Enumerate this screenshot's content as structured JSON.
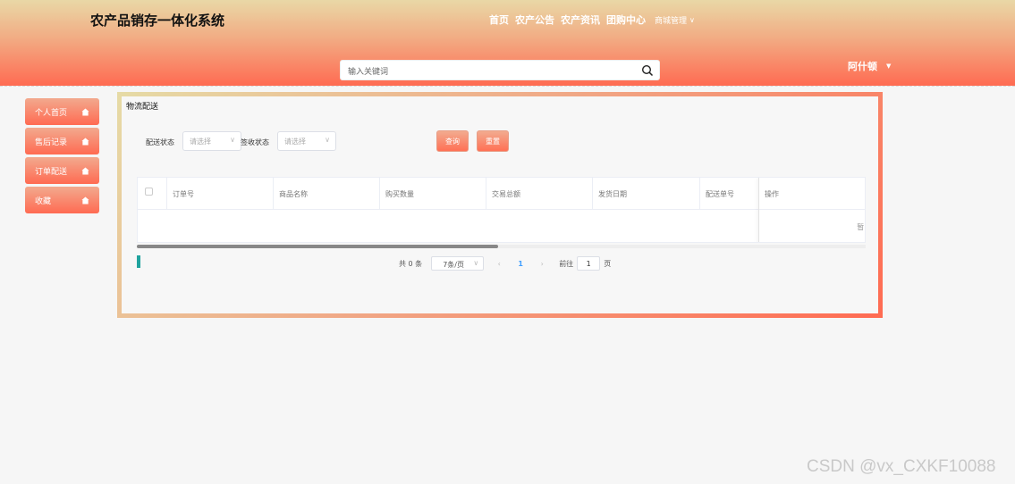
{
  "header": {
    "brand": "农产品销存一体化系统",
    "nav": [
      "首页",
      "农产公告",
      "农产资讯",
      "团购中心"
    ],
    "dropdown_label": "商城管理",
    "search_placeholder": "输入关键词",
    "user_name": "阿什顿"
  },
  "sidebar": {
    "items": [
      {
        "label": "个人首页",
        "icon": "home-icon"
      },
      {
        "label": "售后记录",
        "icon": "home-icon"
      },
      {
        "label": "订单配送",
        "icon": "home-icon"
      },
      {
        "label": "收藏",
        "icon": "home-icon"
      }
    ]
  },
  "panel": {
    "title": "物流配送",
    "filters": [
      {
        "label": "配送状态",
        "placeholder": "请选择"
      },
      {
        "label": "签收状态",
        "placeholder": "请选择"
      }
    ],
    "query_button": "查询",
    "reset_button": "重置"
  },
  "table": {
    "columns": [
      "订单号",
      "商品名称",
      "购买数量",
      "交易总额",
      "发货日期",
      "配送单号"
    ],
    "op_column": "操作",
    "empty_text": "暂:"
  },
  "pagination": {
    "total_text": "共 0 条",
    "page_size": "7条/页",
    "current_page": "1",
    "goto_label": "前往",
    "goto_value": "1",
    "page_suffix": "页"
  },
  "watermark": "CSDN @vx_CXKF10088",
  "colors": {
    "accent": "#ff6b52",
    "header_top": "#e9d8a6",
    "teal": "#20a39e"
  }
}
